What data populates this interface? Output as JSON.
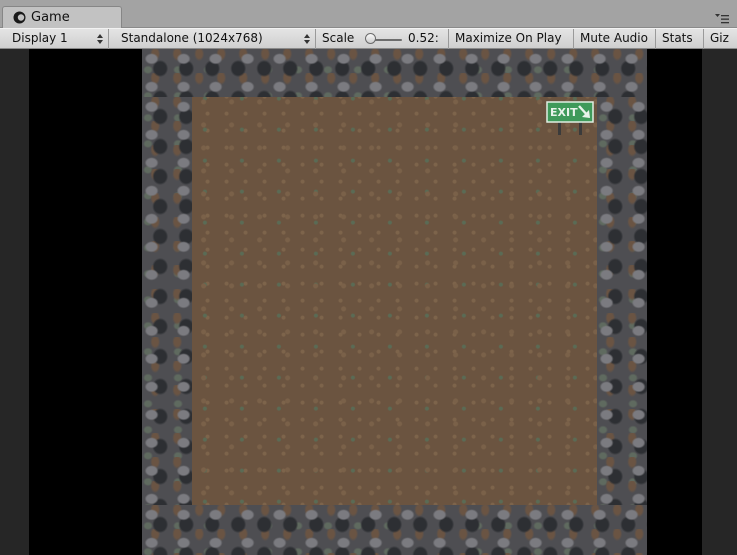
{
  "tab": {
    "title": "Game",
    "icon": "game-view-icon",
    "menu_icon": "tab-menu-icon"
  },
  "toolbar": {
    "display_label": "Display 1",
    "resolution_label": "Standalone (1024x768)",
    "scale_label": "Scale",
    "scale_value": "0.52:",
    "scale_fraction": 0.1,
    "maximize_label": "Maximize On Play",
    "mute_label": "Mute Audio",
    "stats_label": "Stats",
    "gizmos_label": "Giz"
  },
  "game": {
    "exit_sign_text": "EXIT",
    "exit_sign_icon": "exit-arrow-icon"
  },
  "colors": {
    "tab_bg": "#c2c2c2",
    "toolbar_bg": "#dadada",
    "letterbox": "#000000",
    "ground": "#6b5440",
    "rocks": "#4e4e52",
    "exit_sign": "#3f9a5a"
  }
}
